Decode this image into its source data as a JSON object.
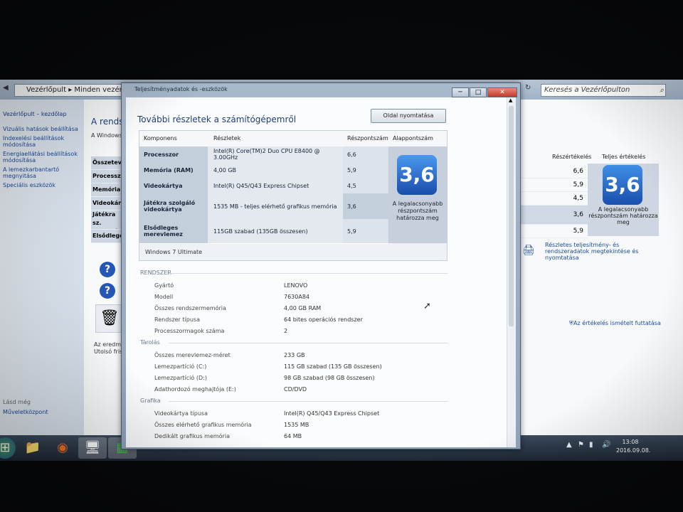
{
  "background_window": {
    "address_parts": [
      "Vezérlőpult",
      "Minden vezérlőp"
    ],
    "search_placeholder": "Keresés a Vezérlőpulton",
    "sidebar": {
      "home": "Vezérlőpult – kezdőlap",
      "links": [
        "Vizuális hatások beállítása",
        "Indexelési beállítások módosítása",
        "Energiaellátási beállítások módosítása",
        "A lemezkarbantartó megnyitása",
        "Speciális eszközök"
      ],
      "see_also": "Lásd még",
      "action_center": "Műveletközpont"
    },
    "main_title": "A rendszer",
    "main_sub": "A Windows",
    "left_table": [
      "Összetevő",
      "Processzor",
      "Memória",
      "Videokártya",
      "Játékra sz. videokártya",
      "Elsődleges"
    ],
    "col_subscore": "Részértékelés",
    "col_base": "Teljes értékelés",
    "subscores": [
      "6,6",
      "5,9",
      "4,5",
      "3,6",
      "5,9"
    ],
    "base_score": "3,6",
    "base_label": "A legalacsonyabb részpontszám határozza meg",
    "detail_link": "Részletes teljesítmény- és rendszeradatok megtekintése és nyomtatása",
    "rerun_link": "Az értékelés ismételt futtatása",
    "bottom_text_1": "Az eredmén",
    "bottom_text_2": "Utolsó friss"
  },
  "taskbar": {
    "clock_time": "13:08",
    "clock_date": "2016.09.08."
  },
  "dialog": {
    "title": "Teljesítményadatok és -eszközök",
    "heading": "További részletek a számítógépemről",
    "print_button": "Oldal nyomtatása",
    "table": {
      "headers": [
        "Komponens",
        "Részletek",
        "Részpontszám",
        "Alappontszám"
      ],
      "rows": [
        {
          "component": "Processzor",
          "details": "Intel(R) Core(TM)2 Duo CPU E8400 @ 3.00GHz",
          "score": "6,6"
        },
        {
          "component": "Memória (RAM)",
          "details": "4,00 GB",
          "score": "5,9"
        },
        {
          "component": "Videokártya",
          "details": "Intel(R) Q45/Q43 Express Chipset",
          "score": "4,5"
        },
        {
          "component": "Játékra szolgáló videokártya",
          "details": "1535 MB - teljes elérhető grafikus memória",
          "score": "3,6"
        },
        {
          "component": "Elsődleges merevlemez",
          "details": "115GB szabad (135GB összesen)",
          "score": "5,9"
        }
      ],
      "base_score": "3,6",
      "base_label": "A legalacsonyabb részpontszám határozza meg",
      "os_edition": "Windows 7 Ultimate"
    },
    "sections": {
      "system": {
        "title": "RENDSZER",
        "rows": [
          {
            "k": "Gyártó",
            "v": "LENOVO"
          },
          {
            "k": "Modell",
            "v": "7630A84"
          },
          {
            "k": "Összes rendszermemória",
            "v": "4,00 GB RAM"
          },
          {
            "k": "Rendszer típusa",
            "v": "64 bites operációs rendszer"
          },
          {
            "k": "Processzormagok száma",
            "v": "2"
          }
        ]
      },
      "storage": {
        "title": "Tárolás",
        "rows": [
          {
            "k": "Összes merevlemez-méret",
            "v": "233 GB"
          },
          {
            "k": "Lemezpartíció (C:)",
            "v": "115 GB szabad (135 GB összesen)"
          },
          {
            "k": "Lemezpartíció (D:)",
            "v": "98 GB szabad (98 GB összesen)"
          },
          {
            "k": "Adathordozó meghajtója (E:)",
            "v": "CD/DVD"
          }
        ]
      },
      "graphics": {
        "title": "Grafika",
        "rows": [
          {
            "k": "Videokártya típusa",
            "v": "Intel(R) Q45/Q43 Express Chipset"
          },
          {
            "k": "Összes elérhető grafikus memória",
            "v": "1535 MB"
          },
          {
            "k": "Dedikált grafikus memória",
            "v": "64 MB"
          }
        ]
      }
    }
  }
}
